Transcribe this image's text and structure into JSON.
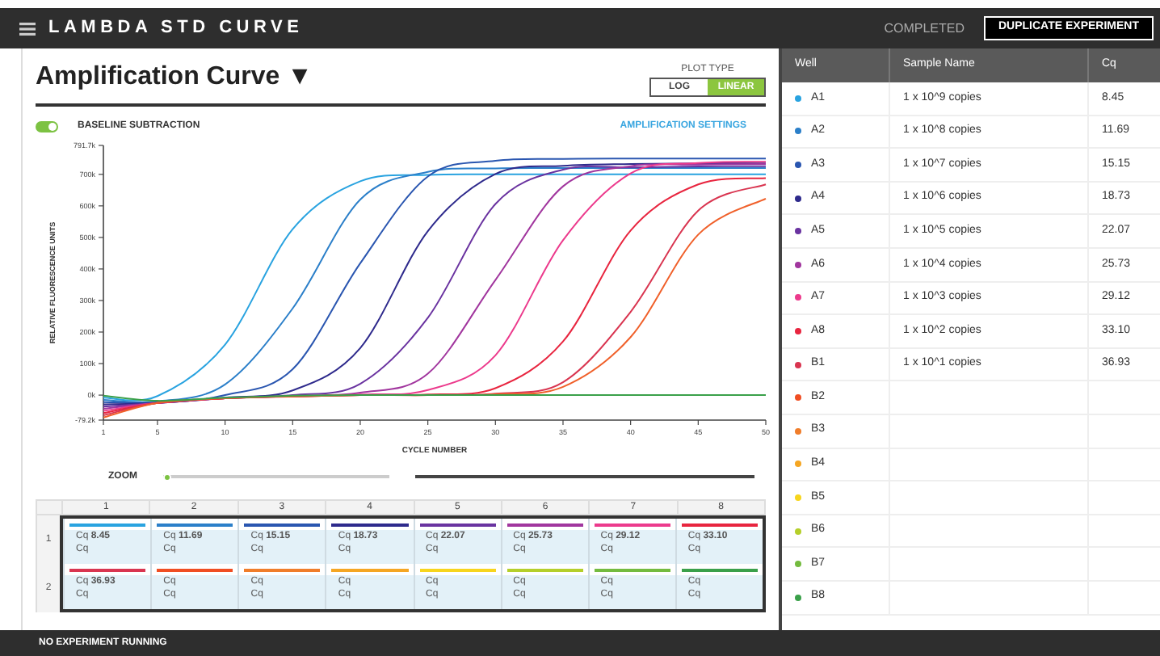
{
  "header": {
    "title": "LAMBDA STD CURVE",
    "status": "COMPLETED",
    "action": "DUPLICATE EXPERIMENT"
  },
  "panel": {
    "title": "Amplification Curve ▼",
    "plot_type": {
      "label": "PLOT TYPE",
      "options": [
        {
          "label": "LOG",
          "selected": false
        },
        {
          "label": "LINEAR",
          "selected": true
        }
      ]
    },
    "baseline": {
      "label": "BASELINE SUBTRACTION",
      "on": true
    },
    "settings_link": "AMPLIFICATION SETTINGS",
    "chart_data": {
      "type": "line",
      "xlabel": "CYCLE NUMBER",
      "ylabel": "RELATIVE FLUORESCENCE UNITS",
      "x": [
        1,
        5,
        10,
        15,
        20,
        25,
        30,
        35,
        40,
        45,
        50
      ],
      "xlim": [
        1,
        50
      ],
      "ylim": [
        -79200,
        791700
      ],
      "xticks": [
        1,
        5,
        10,
        15,
        20,
        25,
        30,
        35,
        40,
        45,
        50
      ],
      "yticks": [
        {
          "value": -79200,
          "label": "-79.2k"
        },
        {
          "value": 0,
          "label": "0k"
        },
        {
          "value": 100000,
          "label": "100k"
        },
        {
          "value": 200000,
          "label": "200k"
        },
        {
          "value": 300000,
          "label": "300k"
        },
        {
          "value": 400000,
          "label": "400k"
        },
        {
          "value": 500000,
          "label": "500k"
        },
        {
          "value": 600000,
          "label": "600k"
        },
        {
          "value": 700000,
          "label": "700k"
        },
        {
          "value": 791700,
          "label": "791.7k"
        }
      ],
      "series": [
        {
          "color": "#29a3e0",
          "values": [
            -8000,
            -3000,
            160000,
            526000,
            678000,
            698000,
            700000,
            700000,
            700000,
            700000,
            700000
          ]
        },
        {
          "color": "#2b7fc9",
          "values": [
            -15000,
            -20000,
            34000,
            275000,
            620000,
            708000,
            719000,
            720000,
            720000,
            720000,
            720000
          ]
        },
        {
          "color": "#2a56b0",
          "values": [
            -22000,
            -24000,
            0,
            82000,
            418000,
            693000,
            743000,
            749000,
            750000,
            750000,
            750000
          ]
        },
        {
          "color": "#2e2a8c",
          "values": [
            -29000,
            -25000,
            -8000,
            15000,
            149000,
            520000,
            701000,
            727000,
            733000,
            735000,
            735000
          ]
        },
        {
          "color": "#6a33a0",
          "values": [
            -36000,
            -25000,
            -10000,
            0,
            36000,
            245000,
            606000,
            715000,
            722000,
            725000,
            726000
          ]
        },
        {
          "color": "#a1369e",
          "values": [
            -43000,
            -25000,
            -10000,
            -3000,
            8000,
            68000,
            365000,
            662000,
            726000,
            731000,
            733000
          ]
        },
        {
          "color": "#ec3a8c",
          "values": [
            -50000,
            -25000,
            -10000,
            -4000,
            2000,
            16000,
            126000,
            491000,
            703000,
            736000,
            740000
          ]
        },
        {
          "color": "#e8253f",
          "values": [
            -57000,
            -25000,
            -10000,
            -4000,
            0,
            2000,
            22000,
            170000,
            522000,
            668000,
            688000
          ]
        },
        {
          "color": "#d93550",
          "values": [
            -64000,
            -25000,
            -10000,
            -4000,
            0,
            0,
            5000,
            41000,
            264000,
            585000,
            668000
          ]
        },
        {
          "color": "#f0602a",
          "values": [
            -71000,
            -25000,
            -10000,
            -4000,
            0,
            0,
            3000,
            26000,
            184000,
            509000,
            623000
          ]
        },
        {
          "color": "#3aa04a",
          "values": [
            -2000,
            -18000,
            -8000,
            -2000,
            0,
            0,
            0,
            0,
            0,
            0,
            0
          ]
        }
      ]
    },
    "zoom": {
      "label": "ZOOM",
      "level": 0
    }
  },
  "plate": {
    "columns": [
      "1",
      "2",
      "3",
      "4",
      "5",
      "6",
      "7",
      "8"
    ],
    "rows": [
      {
        "label": "1",
        "wells": [
          {
            "color": "#29a3e0",
            "line_1": "Cq **8.45**",
            "line_2": "Cq"
          },
          {
            "color": "#2b7fc9",
            "line_1": "Cq **11.69**",
            "line_2": "Cq"
          },
          {
            "color": "#2a56b0",
            "line_1": "Cq **15.15**",
            "line_2": "Cq"
          },
          {
            "color": "#2e2a8c",
            "line_1": "Cq **18.73**",
            "line_2": "Cq"
          },
          {
            "color": "#6a33a0",
            "line_1": "Cq **22.07**",
            "line_2": "Cq"
          },
          {
            "color": "#a1369e",
            "line_1": "Cq **25.73**",
            "line_2": "Cq"
          },
          {
            "color": "#ec3a8c",
            "line_1": "Cq **29.12**",
            "line_2": "Cq"
          },
          {
            "color": "#e8253f",
            "line_1": "Cq **33.10**",
            "line_2": "Cq"
          }
        ]
      },
      {
        "label": "2",
        "wells": [
          {
            "color": "#d93550",
            "line_1": "Cq **36.93**",
            "line_2": "Cq"
          },
          {
            "color": "#f04e23",
            "line_1": "Cq",
            "line_2": "Cq"
          },
          {
            "color": "#f07d2a",
            "line_1": "Cq",
            "line_2": "Cq"
          },
          {
            "color": "#f5a623",
            "line_1": "Cq",
            "line_2": "Cq"
          },
          {
            "color": "#f7d51d",
            "line_1": "Cq",
            "line_2": "Cq"
          },
          {
            "color": "#b5cf2a",
            "line_1": "Cq",
            "line_2": "Cq"
          },
          {
            "color": "#74bb3f",
            "line_1": "Cq",
            "line_2": "Cq"
          },
          {
            "color": "#3aa04a",
            "line_1": "Cq",
            "line_2": "Cq"
          }
        ]
      }
    ]
  },
  "well_table": {
    "columns": [
      "Well",
      "Sample Name",
      "Cq"
    ],
    "rows": [
      {
        "well": "A1",
        "color": "#29a3e0",
        "sample": "1 x 10^9 copies",
        "cq": "8.45"
      },
      {
        "well": "A2",
        "color": "#2b7fc9",
        "sample": "1 x 10^8 copies",
        "cq": "11.69"
      },
      {
        "well": "A3",
        "color": "#2a56b0",
        "sample": "1 x 10^7 copies",
        "cq": "15.15"
      },
      {
        "well": "A4",
        "color": "#2e2a8c",
        "sample": "1 x 10^6 copies",
        "cq": "18.73"
      },
      {
        "well": "A5",
        "color": "#6a33a0",
        "sample": "1 x 10^5 copies",
        "cq": "22.07"
      },
      {
        "well": "A6",
        "color": "#a1369e",
        "sample": "1 x 10^4 copies",
        "cq": "25.73"
      },
      {
        "well": "A7",
        "color": "#ec3a8c",
        "sample": "1 x 10^3 copies",
        "cq": "29.12"
      },
      {
        "well": "A8",
        "color": "#e8253f",
        "sample": "1 x 10^2 copies",
        "cq": "33.10"
      },
      {
        "well": "B1",
        "color": "#d93550",
        "sample": "1 x 10^1 copies",
        "cq": "36.93"
      },
      {
        "well": "B2",
        "color": "#f04e23"
      },
      {
        "well": "B3",
        "color": "#f07d2a"
      },
      {
        "well": "B4",
        "color": "#f5a623"
      },
      {
        "well": "B5",
        "color": "#f7d51d"
      },
      {
        "well": "B6",
        "color": "#b5cf2a"
      },
      {
        "well": "B7",
        "color": "#74bb3f"
      },
      {
        "well": "B8",
        "color": "#3aa04a"
      }
    ]
  },
  "status_bar": "NO EXPERIMENT RUNNING"
}
